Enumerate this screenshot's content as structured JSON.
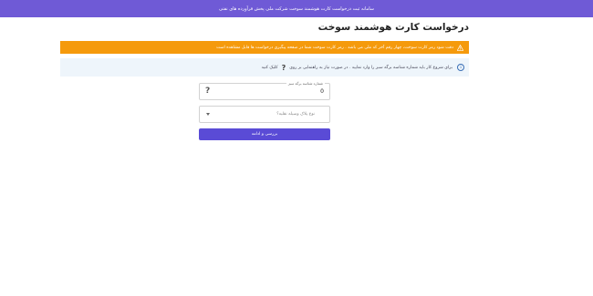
{
  "header": {
    "banner": "سامانه ثبت درخواست کارت هوشمند سوخت شرکت ملی پخش فرآورده های نفتی"
  },
  "page": {
    "title": "درخواست کارت هوشمند سوخت"
  },
  "alerts": {
    "warning": "دقت شود رمز کارت سوخت، چهار رقم آخر کد ملی می باشد . رمز کارت سوخت شما در صفحه پیگیری درخواست ها قابل مشاهده است",
    "info_text": "برای شروع کار باید شماره شناسه برگه سبز را وارد نمایید . در صورت نیاز به راهنمایی بر روی",
    "info_help_symbol": "?",
    "info_suffix": "کلیک کنید"
  },
  "form": {
    "green_sheet_label": "شماره شناسه برگه سبز",
    "green_sheet_value": "0",
    "help_symbol": "?",
    "plate_placeholder": "نوع پلاک وسیله نقلیه؟",
    "submit_label": "بررسی و ادامه"
  },
  "colors": {
    "banner": "#6f5ad6",
    "warning": "#f59a0c",
    "info_bg": "#eef5fb",
    "button": "#5a4bd6"
  },
  "icons": {
    "warning": "warning-triangle-icon",
    "info": "info-circle-icon",
    "dropdown": "chevron-down-icon"
  }
}
